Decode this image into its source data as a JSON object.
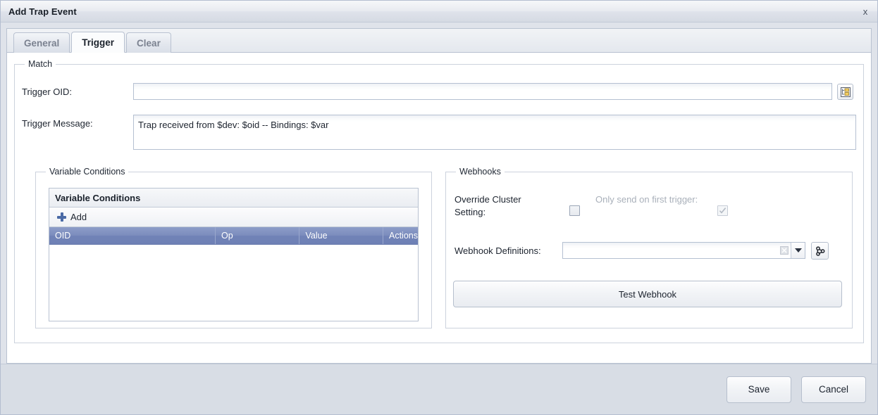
{
  "window": {
    "title": "Add Trap Event",
    "close_label": "x",
    "close_icon": "close-icon"
  },
  "tabs": [
    {
      "label": "General",
      "active": false
    },
    {
      "label": "Trigger",
      "active": true
    },
    {
      "label": "Clear",
      "active": false
    }
  ],
  "match": {
    "legend": "Match",
    "trigger_oid": {
      "label": "Trigger OID:",
      "value": "",
      "placeholder": "",
      "browse_icon": "oid-tree-browse-icon"
    },
    "trigger_message": {
      "label": "Trigger Message:",
      "value": "Trap received from $dev: $oid -- Bindings: $var",
      "placeholder": ""
    }
  },
  "variable_conditions": {
    "legend": "Variable Conditions",
    "grid_title": "Variable Conditions",
    "toolbar": {
      "add_label": "Add",
      "add_icon": "plus-icon"
    },
    "columns": [
      "OID",
      "Op",
      "Value",
      "Actions"
    ],
    "rows": []
  },
  "webhooks": {
    "legend": "Webhooks",
    "override_cluster_setting": {
      "label": "Override Cluster Setting:",
      "checked": false,
      "disabled": false
    },
    "only_send_on_first_trigger": {
      "label": "Only send on first trigger:",
      "checked": true,
      "disabled": true
    },
    "webhook_definitions": {
      "label": "Webhook Definitions:",
      "value": "",
      "placeholder": "",
      "clear_icon": "clear-x-icon",
      "dropdown_icon": "chevron-down-icon",
      "manage_icon": "webhook-icon"
    },
    "test_button": "Test Webhook"
  },
  "footer": {
    "save_label": "Save",
    "cancel_label": "Cancel"
  },
  "colors": {
    "grid_header": "#7b8cbd",
    "accent_plus": "#4a6aa5",
    "footer_bg": "#d8dde5",
    "border": "#b9c2d1"
  }
}
